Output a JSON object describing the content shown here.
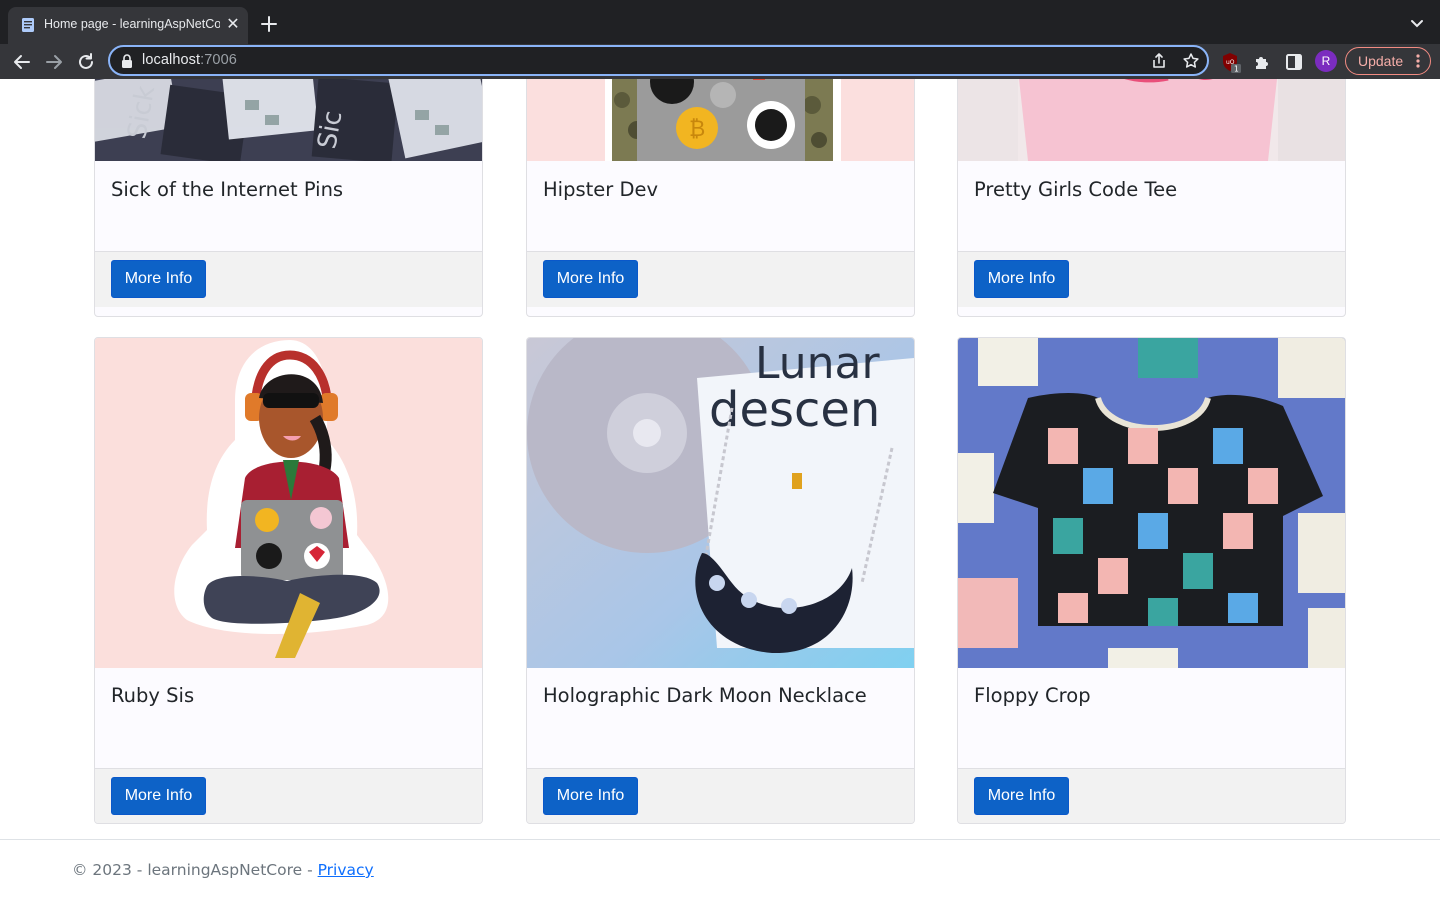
{
  "browser": {
    "tab_title": "Home page - learningAspNetCore",
    "url_host": "localhost",
    "url_port": ":7006",
    "profile_initial": "R",
    "update_label": "Update",
    "ext_badge": "1"
  },
  "products": [
    {
      "name": "Sick of the Internet Pins",
      "button": "More Info"
    },
    {
      "name": "Hipster Dev",
      "button": "More Info"
    },
    {
      "name": "Pretty Girls Code Tee",
      "button": "More Info"
    },
    {
      "name": "Ruby Sis",
      "button": "More Info"
    },
    {
      "name": "Holographic Dark Moon Necklace",
      "button": "More Info"
    },
    {
      "name": "Floppy Crop",
      "button": "More Info"
    }
  ],
  "footer": {
    "copyright": "© 2023 - learningAspNetCore - ",
    "privacy_link": "Privacy"
  },
  "colors": {
    "primary_button": "#0d62c7",
    "link": "#0d6efd"
  }
}
